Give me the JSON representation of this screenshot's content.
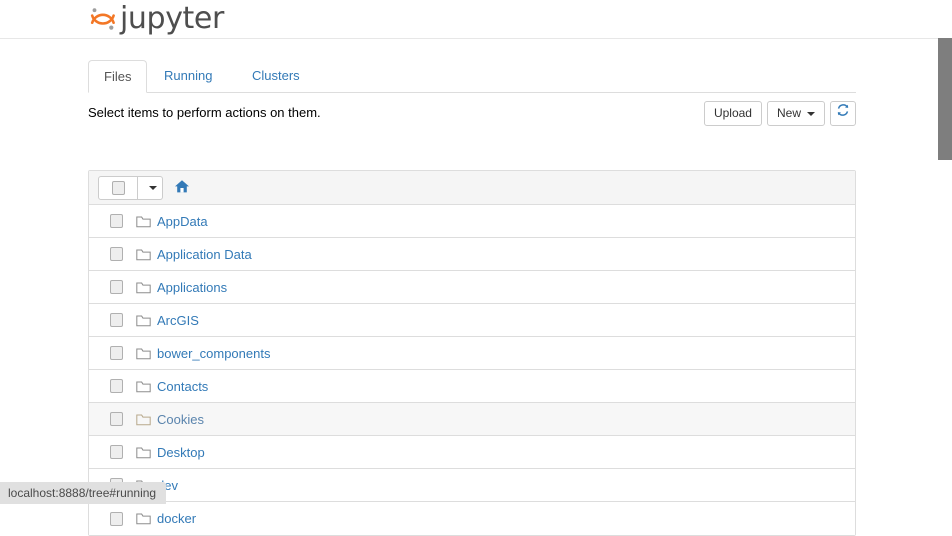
{
  "header": {
    "logo_text": "jupyter",
    "logo_icon": "jupyter-logo-icon",
    "logo_color": "#f37726"
  },
  "tabs": [
    {
      "label": "Files",
      "active": true
    },
    {
      "label": "Running",
      "active": false
    },
    {
      "label": "Clusters",
      "active": false
    }
  ],
  "actionbar": {
    "hint": "Select items to perform actions on them.",
    "upload_label": "Upload",
    "new_label": "New",
    "refresh_icon": "refresh-icon"
  },
  "list_header": {
    "select_all_icon": "checkbox-icon",
    "dropdown_icon": "caret-down-icon",
    "breadcrumb_icon": "home-icon"
  },
  "files": [
    {
      "name": "AppData",
      "type": "folder",
      "hovered": false
    },
    {
      "name": "Application Data",
      "type": "folder",
      "hovered": false
    },
    {
      "name": "Applications",
      "type": "folder",
      "hovered": false
    },
    {
      "name": "ArcGIS",
      "type": "folder",
      "hovered": false
    },
    {
      "name": "bower_components",
      "type": "folder",
      "hovered": false
    },
    {
      "name": "Contacts",
      "type": "folder",
      "hovered": false
    },
    {
      "name": "Cookies",
      "type": "folder",
      "hovered": true
    },
    {
      "name": "Desktop",
      "type": "folder",
      "hovered": false
    },
    {
      "name": "dev",
      "type": "folder",
      "hovered": false
    },
    {
      "name": "docker",
      "type": "folder",
      "hovered": false
    }
  ],
  "statusbar": {
    "url": "localhost:8888/tree#running"
  },
  "colors": {
    "link": "#337ab7",
    "folder_outline": "#8d8d8d",
    "header_bg": "#f5f5f5",
    "border": "#dddddd"
  }
}
